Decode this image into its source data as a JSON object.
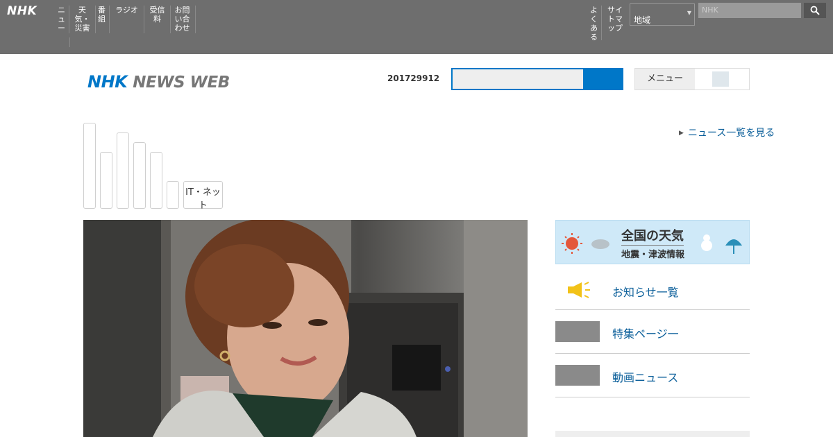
{
  "portal": {
    "logo": "NHK",
    "nav": [
      "ニュース",
      "天気・災害",
      "番組",
      "ラジオ",
      "受信料",
      "お問い合わせ"
    ],
    "right_nav": [
      "よくある",
      "サイトマップ"
    ],
    "region": "地域",
    "search_placeholder": "NHK"
  },
  "header": {
    "logo_part1": "NHK",
    "logo_part2": "NEWS WEB",
    "date": "201729912",
    "search_value": "",
    "menu_label": "メニュー"
  },
  "genres": {
    "tabs": [
      "",
      "",
      "",
      "",
      "",
      ""
    ],
    "it_tab": "IT・ネット",
    "list_link": "ニュース一覧を見る"
  },
  "sidebar": {
    "weather_title": "全国の天気",
    "weather_sub": "地震・津波情報",
    "items": [
      {
        "label": "お知らせ一覧"
      },
      {
        "label": "特集ページ一"
      },
      {
        "label": "動画ニュース"
      }
    ]
  },
  "colors": {
    "brand_blue": "#0077c8",
    "link_blue": "#0b5f9a",
    "portal_gray": "#6e6e6e"
  }
}
